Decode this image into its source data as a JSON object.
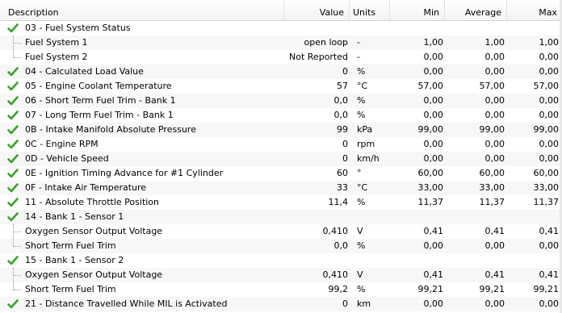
{
  "header": {
    "description": "Description",
    "value": "Value",
    "units": "Units",
    "min": "Min",
    "average": "Average",
    "max": "Max"
  },
  "rows": [
    {
      "kind": "parent",
      "desc": "03 - Fuel System Status",
      "value": "",
      "unit": "",
      "min": "",
      "avg": "",
      "max": ""
    },
    {
      "kind": "child",
      "desc": "Fuel System 1",
      "value": "open loop",
      "unit": "-",
      "min": "1,00",
      "avg": "1,00",
      "max": "1,00"
    },
    {
      "kind": "child-last",
      "desc": "Fuel System 2",
      "value": "Not Reported",
      "unit": "-",
      "min": "0,00",
      "avg": "0,00",
      "max": "0,00"
    },
    {
      "kind": "item",
      "desc": "04 - Calculated Load Value",
      "value": "0",
      "unit": "%",
      "min": "0,00",
      "avg": "0,00",
      "max": "0,00"
    },
    {
      "kind": "item",
      "desc": "05 - Engine Coolant Temperature",
      "value": "57",
      "unit": "°C",
      "min": "57,00",
      "avg": "57,00",
      "max": "57,00"
    },
    {
      "kind": "item",
      "desc": "06 - Short Term Fuel Trim - Bank 1",
      "value": "0,0",
      "unit": "%",
      "min": "0,00",
      "avg": "0,00",
      "max": "0,00"
    },
    {
      "kind": "item",
      "desc": "07 - Long Term Fuel Trim - Bank 1",
      "value": "0,0",
      "unit": "%",
      "min": "0,00",
      "avg": "0,00",
      "max": "0,00"
    },
    {
      "kind": "item",
      "desc": "0B - Intake Manifold Absolute Pressure",
      "value": "99",
      "unit": "kPa",
      "min": "99,00",
      "avg": "99,00",
      "max": "99,00"
    },
    {
      "kind": "item",
      "desc": "0C - Engine RPM",
      "value": "0",
      "unit": "rpm",
      "min": "0,00",
      "avg": "0,00",
      "max": "0,00"
    },
    {
      "kind": "item",
      "desc": "0D - Vehicle Speed",
      "value": "0",
      "unit": "km/h",
      "min": "0,00",
      "avg": "0,00",
      "max": "0,00"
    },
    {
      "kind": "item",
      "desc": "0E - Ignition Timing Advance for #1 Cylinder",
      "value": "60",
      "unit": "°",
      "min": "60,00",
      "avg": "60,00",
      "max": "60,00"
    },
    {
      "kind": "item",
      "desc": "0F - Intake Air Temperature",
      "value": "33",
      "unit": "°C",
      "min": "33,00",
      "avg": "33,00",
      "max": "33,00"
    },
    {
      "kind": "item",
      "desc": "11 - Absolute Throttle Position",
      "value": "11,4",
      "unit": "%",
      "min": "11,37",
      "avg": "11,37",
      "max": "11,37"
    },
    {
      "kind": "parent",
      "desc": "14 - Bank 1 - Sensor 1",
      "value": "",
      "unit": "",
      "min": "",
      "avg": "",
      "max": ""
    },
    {
      "kind": "child",
      "desc": "Oxygen Sensor Output Voltage",
      "value": "0,410",
      "unit": "V",
      "min": "0,41",
      "avg": "0,41",
      "max": "0,41"
    },
    {
      "kind": "child-last",
      "desc": "Short Term Fuel Trim",
      "value": "0,0",
      "unit": "%",
      "min": "0,00",
      "avg": "0,00",
      "max": "0,00"
    },
    {
      "kind": "parent",
      "desc": "15 - Bank 1 - Sensor 2",
      "value": "",
      "unit": "",
      "min": "",
      "avg": "",
      "max": ""
    },
    {
      "kind": "child",
      "desc": "Oxygen Sensor Output Voltage",
      "value": "0,410",
      "unit": "V",
      "min": "0,41",
      "avg": "0,41",
      "max": "0,41"
    },
    {
      "kind": "child-last",
      "desc": "Short Term Fuel Trim",
      "value": "99,2",
      "unit": "%",
      "min": "99,21",
      "avg": "99,21",
      "max": "99,21"
    },
    {
      "kind": "item",
      "desc": "21 - Distance Travelled While MIL is Activated",
      "value": "0",
      "unit": "km",
      "min": "0,00",
      "avg": "0,00",
      "max": "0,00"
    }
  ],
  "icons": {
    "checked": "check-icon"
  },
  "colors": {
    "check": "#3aa02c",
    "alt_row": "#f7f7f7",
    "tree_line": "#9a9a9a"
  }
}
